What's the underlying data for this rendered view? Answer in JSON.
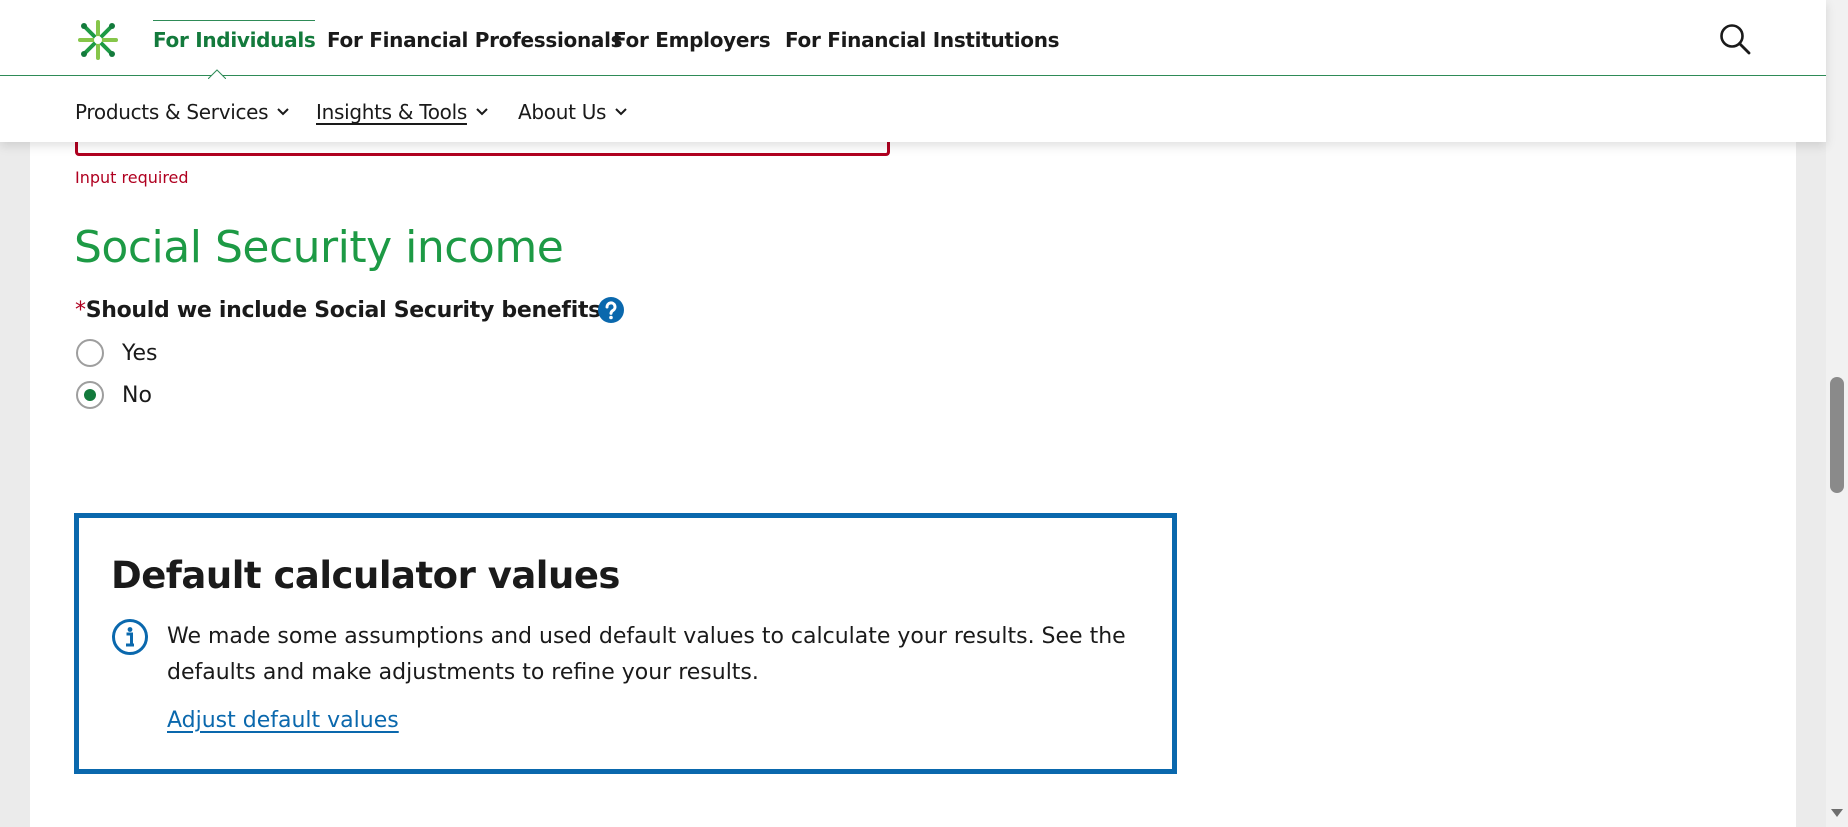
{
  "header": {
    "audience_tabs": [
      {
        "label": "For Individuals",
        "active": true
      },
      {
        "label": "For Financial Professionals",
        "active": false
      },
      {
        "label": "For Employers",
        "active": false
      },
      {
        "label": "For Financial Institutions",
        "active": false
      }
    ],
    "sub_nav": [
      {
        "label": "Products & Services"
      },
      {
        "label": "Insights & Tools"
      },
      {
        "label": "About Us"
      }
    ],
    "search_icon": "search-icon",
    "brand_color": "#137a3c",
    "divider_color": "#2e8b57"
  },
  "form": {
    "error_message": "Input required",
    "error_color": "#b00020",
    "section_title": "Social Security income",
    "section_title_color": "#1d9a45",
    "question": {
      "required_marker": "*",
      "text": "Should we include Social Security benefits?",
      "help_icon": "question-circle-icon"
    },
    "options": [
      {
        "label": "Yes",
        "selected": false
      },
      {
        "label": "No",
        "selected": true
      }
    ]
  },
  "defaults_box": {
    "title": "Default calculator values",
    "info_icon": "info-circle-icon",
    "body": "We made some assumptions and used default values to calculate your results. See the defaults and make adjustments to refine your results.",
    "link": "Adjust default values",
    "accent_color": "#0a68ad"
  }
}
